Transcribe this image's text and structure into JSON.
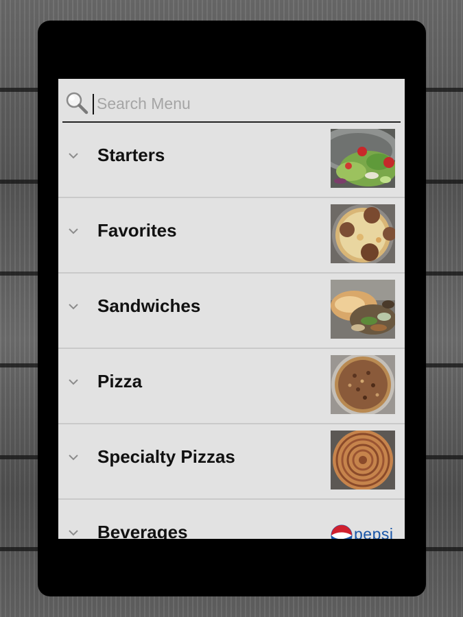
{
  "search": {
    "placeholder": "Search Menu",
    "icon": "magnifier-icon"
  },
  "menu": {
    "items": [
      {
        "label": "Starters",
        "thumbnail": "salad-photo"
      },
      {
        "label": "Favorites",
        "thumbnail": "meatball-pizza-photo"
      },
      {
        "label": "Sandwiches",
        "thumbnail": "cheesesteak-photo"
      },
      {
        "label": "Pizza",
        "thumbnail": "sausage-pizza-photo"
      },
      {
        "label": "Specialty Pizzas",
        "thumbnail": "pinwheel-pizza-photo"
      },
      {
        "label": "Beverages",
        "thumbnail": "pepsi-logo"
      }
    ],
    "pepsi_text": "pepsi"
  },
  "colors": {
    "screen_bg": "#e2e2e2",
    "frame": "#000000",
    "text": "#111111",
    "pepsi_blue": "#1a56a8",
    "pepsi_red": "#d0202e"
  }
}
